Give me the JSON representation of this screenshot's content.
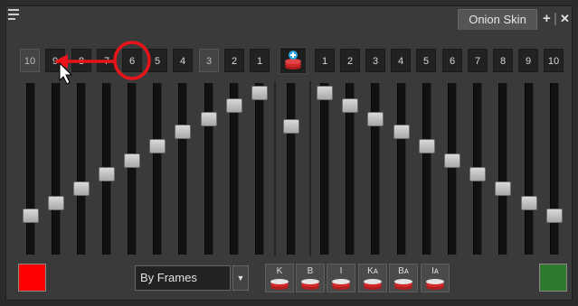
{
  "panel": {
    "tab_label": "Onion Skin",
    "add_symbol": "+",
    "separator": "|",
    "close_symbol": "✕"
  },
  "frames": {
    "previous": [
      "10",
      "9",
      "8",
      "7",
      "6",
      "5",
      "4",
      "3",
      "2",
      "1"
    ],
    "next": [
      "1",
      "2",
      "3",
      "4",
      "5",
      "6",
      "7",
      "8",
      "9",
      "10"
    ]
  },
  "sliders": {
    "previous_levels": [
      0.15,
      0.24,
      0.34,
      0.44,
      0.53,
      0.63,
      0.73,
      0.82,
      0.91,
      1.0
    ],
    "center_level": 0.77,
    "next_levels": [
      1.0,
      0.91,
      0.82,
      0.73,
      0.63,
      0.53,
      0.44,
      0.34,
      0.24,
      0.15
    ]
  },
  "bottom": {
    "mode_value": "By Frames",
    "type_buttons": [
      "K",
      "B",
      "I",
      "Kᴀ",
      "Bᴀ",
      "Iᴀ"
    ]
  },
  "colors": {
    "previous_color": "#ff0000",
    "next_color": "#2f7a2f",
    "annotation_red": "#e8141a"
  }
}
